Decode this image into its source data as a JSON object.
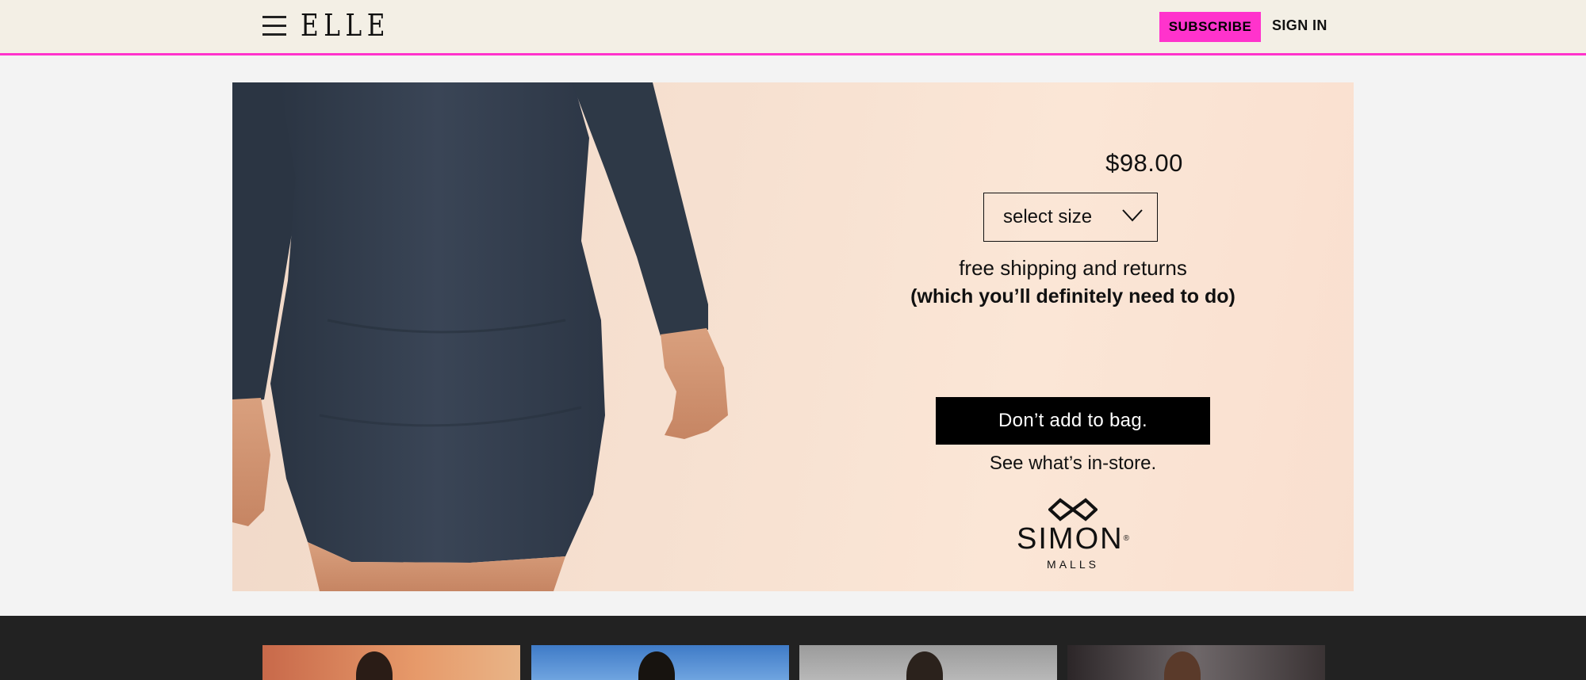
{
  "header": {
    "logo": "ELLE",
    "subscribe_label": "SUBSCRIBE",
    "signin_label": "SIGN IN",
    "accent_color": "#ff33cc"
  },
  "ad": {
    "price": "$98.00",
    "size_select": {
      "selected": "select size"
    },
    "shipping_line1": "free shipping and returns",
    "shipping_line2": "(which you’ll definitely need to do)",
    "cta_label": "Don’t add to bag.",
    "instore_text": "See what’s in-store.",
    "brand_name": "SIMON",
    "brand_sub": "MALLS"
  },
  "strip": {
    "thumbnails": [
      {
        "icon": "photo-thumbnail"
      },
      {
        "icon": "photo-thumbnail"
      },
      {
        "icon": "photo-thumbnail"
      },
      {
        "icon": "photo-thumbnail"
      }
    ]
  }
}
